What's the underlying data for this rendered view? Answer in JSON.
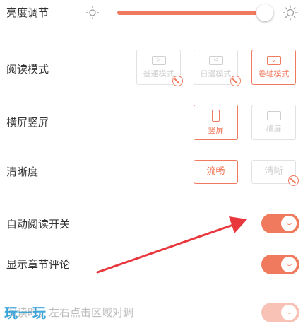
{
  "brightness": {
    "label": "亮度调节",
    "level": 0.97
  },
  "reading_mode": {
    "label": "阅读模式",
    "options": [
      {
        "label": "普通模式",
        "glyph": ">"
      },
      {
        "label": "日漫模式",
        "glyph": "<"
      },
      {
        "label": "卷轴模式",
        "glyph": "⌄"
      }
    ],
    "selected": "卷轴模式"
  },
  "orientation": {
    "label": "横屏竖屏",
    "options": [
      {
        "label": "竖屏"
      },
      {
        "label": "横屏"
      }
    ],
    "selected": "竖屏"
  },
  "clarity": {
    "label": "清晰度",
    "options": [
      {
        "label": "流畅"
      },
      {
        "label": "清晰"
      }
    ],
    "selected": "流畅"
  },
  "auto_read": {
    "label": "自动阅读开关",
    "on": true
  },
  "chapter_comments": {
    "label": "显示章节评论",
    "on": true
  },
  "tap_zone": {
    "label": "阅读时，左右点击区域对调",
    "on": true
  },
  "watermark": "玩一玩",
  "colors": {
    "accent": "#f07a5e",
    "disabled": "#cfcfcf",
    "arrow": "#e8383d"
  }
}
